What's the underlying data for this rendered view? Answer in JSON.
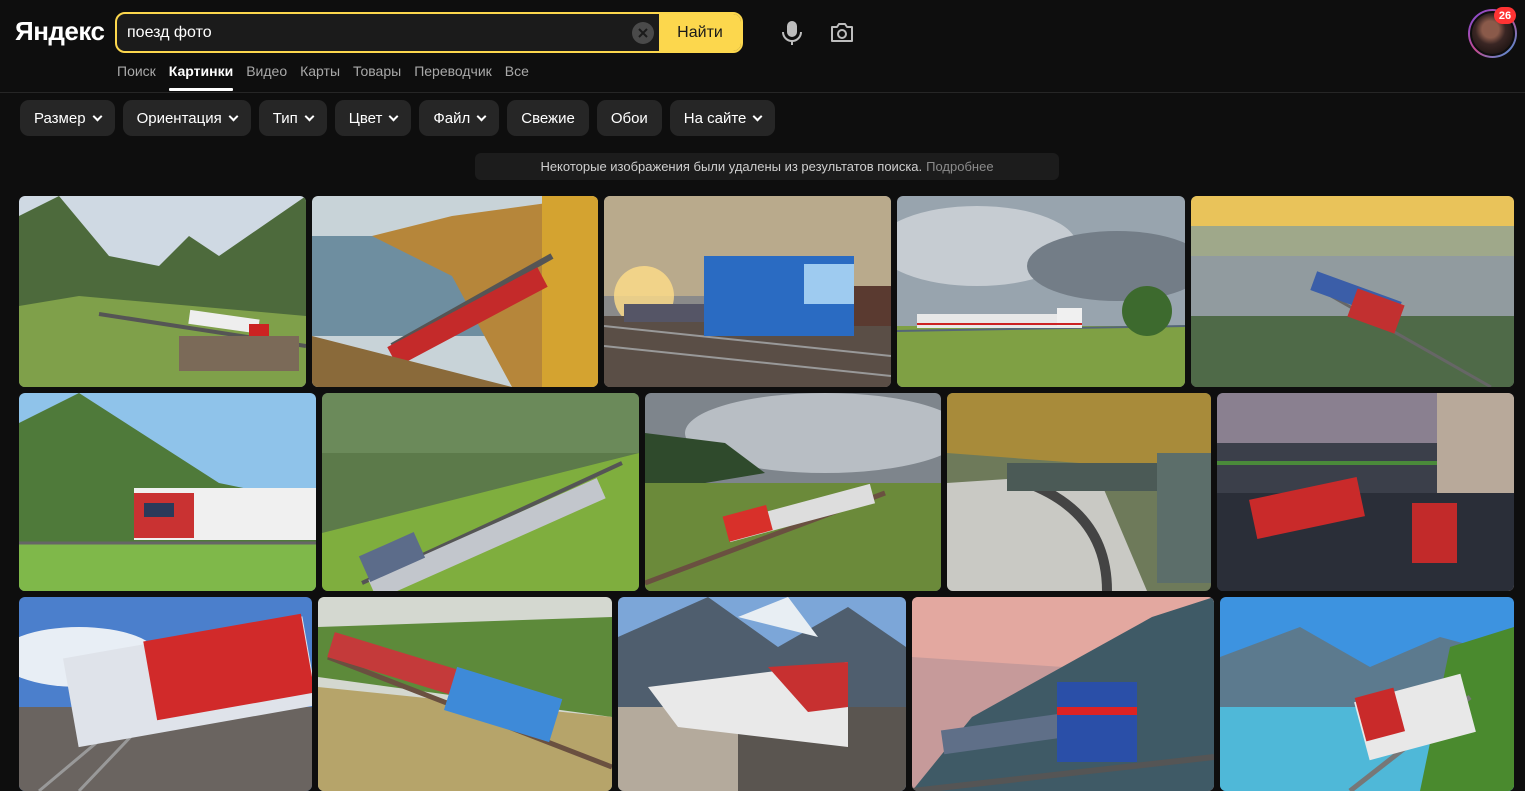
{
  "header": {
    "logo": "Яндекс",
    "search": {
      "value": "поезд фото",
      "placeholder": ""
    },
    "find_label": "Найти",
    "notification_count": "26"
  },
  "tabs": [
    "Поиск",
    "Картинки",
    "Видео",
    "Карты",
    "Товары",
    "Переводчик",
    "Все"
  ],
  "active_tab": "Картинки",
  "filters": [
    {
      "label": "Размер",
      "dropdown": true
    },
    {
      "label": "Ориентация",
      "dropdown": true
    },
    {
      "label": "Тип",
      "dropdown": true
    },
    {
      "label": "Цвет",
      "dropdown": true
    },
    {
      "label": "Файл",
      "dropdown": true
    },
    {
      "label": "Свежие",
      "dropdown": false
    },
    {
      "label": "Обои",
      "dropdown": false
    },
    {
      "label": "На сайте",
      "dropdown": true
    }
  ],
  "notice": {
    "text": "Некоторые изображения были удалены из результатов поиска.",
    "link": "Подробнее"
  },
  "results_rows": 3,
  "results_count_visible": 15,
  "colors": {
    "accent": "#fcd74d",
    "background": "#0e0e0e",
    "chip": "#262626"
  }
}
